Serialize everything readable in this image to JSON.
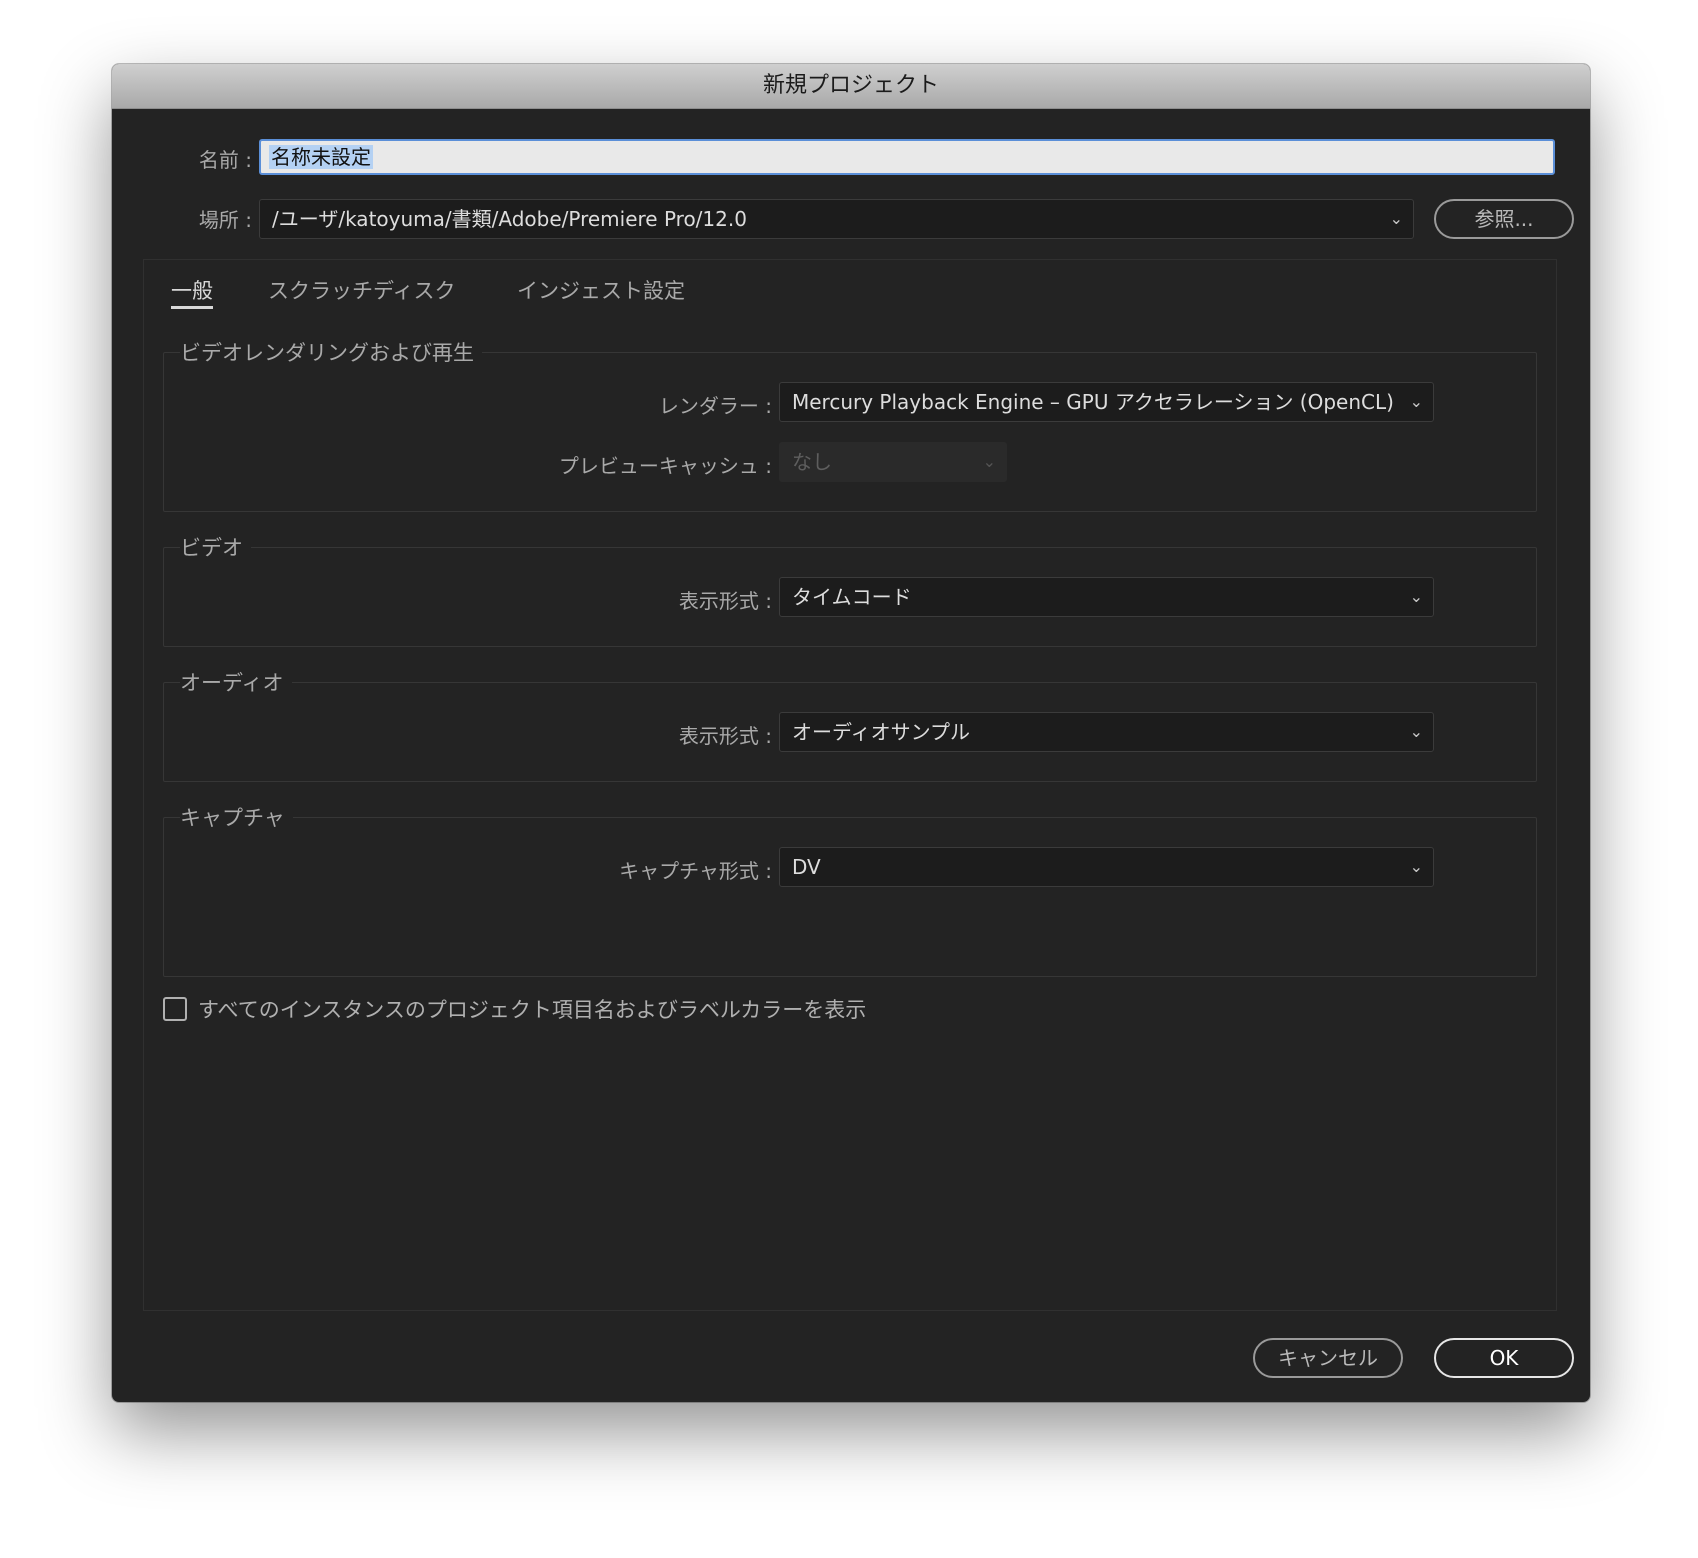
{
  "window": {
    "title": "新規プロジェクト"
  },
  "name_row": {
    "label": "名前 :",
    "value": "名称未設定"
  },
  "location_row": {
    "label": "場所 :",
    "value": "/ユーザ/katoyuma/書類/Adobe/Premiere Pro/12.0",
    "browse_label": "参照..."
  },
  "tabs": [
    {
      "label": "一般",
      "active": true
    },
    {
      "label": "スクラッチディスク",
      "active": false
    },
    {
      "label": "インジェスト設定",
      "active": false
    }
  ],
  "video_rendering": {
    "title": "ビデオレンダリングおよび再生",
    "renderer_label": "レンダラー :",
    "renderer_value": "Mercury Playback Engine – GPU アクセラレーション (OpenCL)",
    "preview_cache_label": "プレビューキャッシュ :",
    "preview_cache_value": "なし"
  },
  "video": {
    "title": "ビデオ",
    "display_format_label": "表示形式 :",
    "display_format_value": "タイムコード"
  },
  "audio": {
    "title": "オーディオ",
    "display_format_label": "表示形式 :",
    "display_format_value": "オーディオサンプル"
  },
  "capture": {
    "title": "キャプチャ",
    "format_label": "キャプチャ形式 :",
    "format_value": "DV"
  },
  "show_labels_checkbox": {
    "label": "すべてのインスタンスのプロジェクト項目名およびラベルカラーを表示",
    "checked": false
  },
  "footer": {
    "cancel_label": "キャンセル",
    "ok_label": "OK"
  },
  "icons": {
    "dropdown": "chevron-down-icon"
  }
}
